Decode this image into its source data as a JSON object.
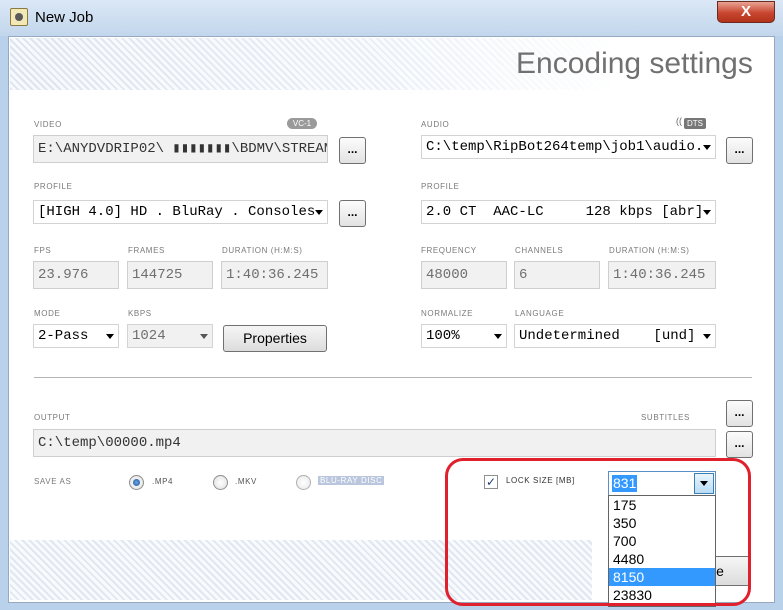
{
  "window": {
    "title": "New Job",
    "close_label": "X"
  },
  "header": {
    "title": "Encoding settings"
  },
  "video": {
    "label": "VIDEO",
    "codec_badge": "VC-1",
    "path": "E:\\ANYDVDRIP02\\ ▮▮▮▮▮▮▮\\BDMV\\STREAM\\",
    "browse_label": "...",
    "profile_label": "PROFILE",
    "profile_value": "[HIGH 4.0] HD . BluRay . Consoles",
    "profile_browse_label": "...",
    "fps_label": "FPS",
    "fps_value": "23.976",
    "frames_label": "FRAMES",
    "frames_value": "144725",
    "duration_label": "DURATION (H:M:S)",
    "duration_value": "1:40:36.245",
    "mode_label": "MODE",
    "mode_value": "2-Pass",
    "kbps_label": "KBPS",
    "kbps_value": "1024",
    "properties_label": "Properties"
  },
  "audio": {
    "label": "AUDIO",
    "codec_badge": "DTS",
    "path": "C:\\temp\\RipBot264temp\\job1\\audio.",
    "browse_label": "...",
    "profile_label": "PROFILE",
    "profile_value": "2.0 CT  AAC-LC     128 kbps [abr]",
    "frequency_label": "FREQUENCY",
    "frequency_value": "48000",
    "channels_label": "CHANNELS",
    "channels_value": "6",
    "duration_label": "DURATION (H:M:S)",
    "duration_value": "1:40:36.245",
    "normalize_label": "NORMALIZE",
    "normalize_value": "100%",
    "language_label": "LANGUAGE",
    "language_value": "Undetermined    [und]"
  },
  "output": {
    "label": "OUTPUT",
    "subtitles_label": "SUBTITLES",
    "subtitles_browse_label": "...",
    "path": "C:\\temp\\00000.mp4",
    "browse_label": "...",
    "save_as_label": "SAVE AS",
    "formats": [
      ".MP4",
      ".MKV",
      "BLU-RAY DISC"
    ],
    "selected_format": ".MP4",
    "lock_size_label": "LOCK SIZE [MB]",
    "lock_size_checked": true,
    "lock_size_value": "831",
    "size_options": [
      "175",
      "350",
      "700",
      "4480",
      "8150",
      "23830"
    ],
    "highlighted_option": "8150",
    "covered_button_label": "e"
  },
  "annotation_color": "#e0202d",
  "accent_color": "#3399ff"
}
